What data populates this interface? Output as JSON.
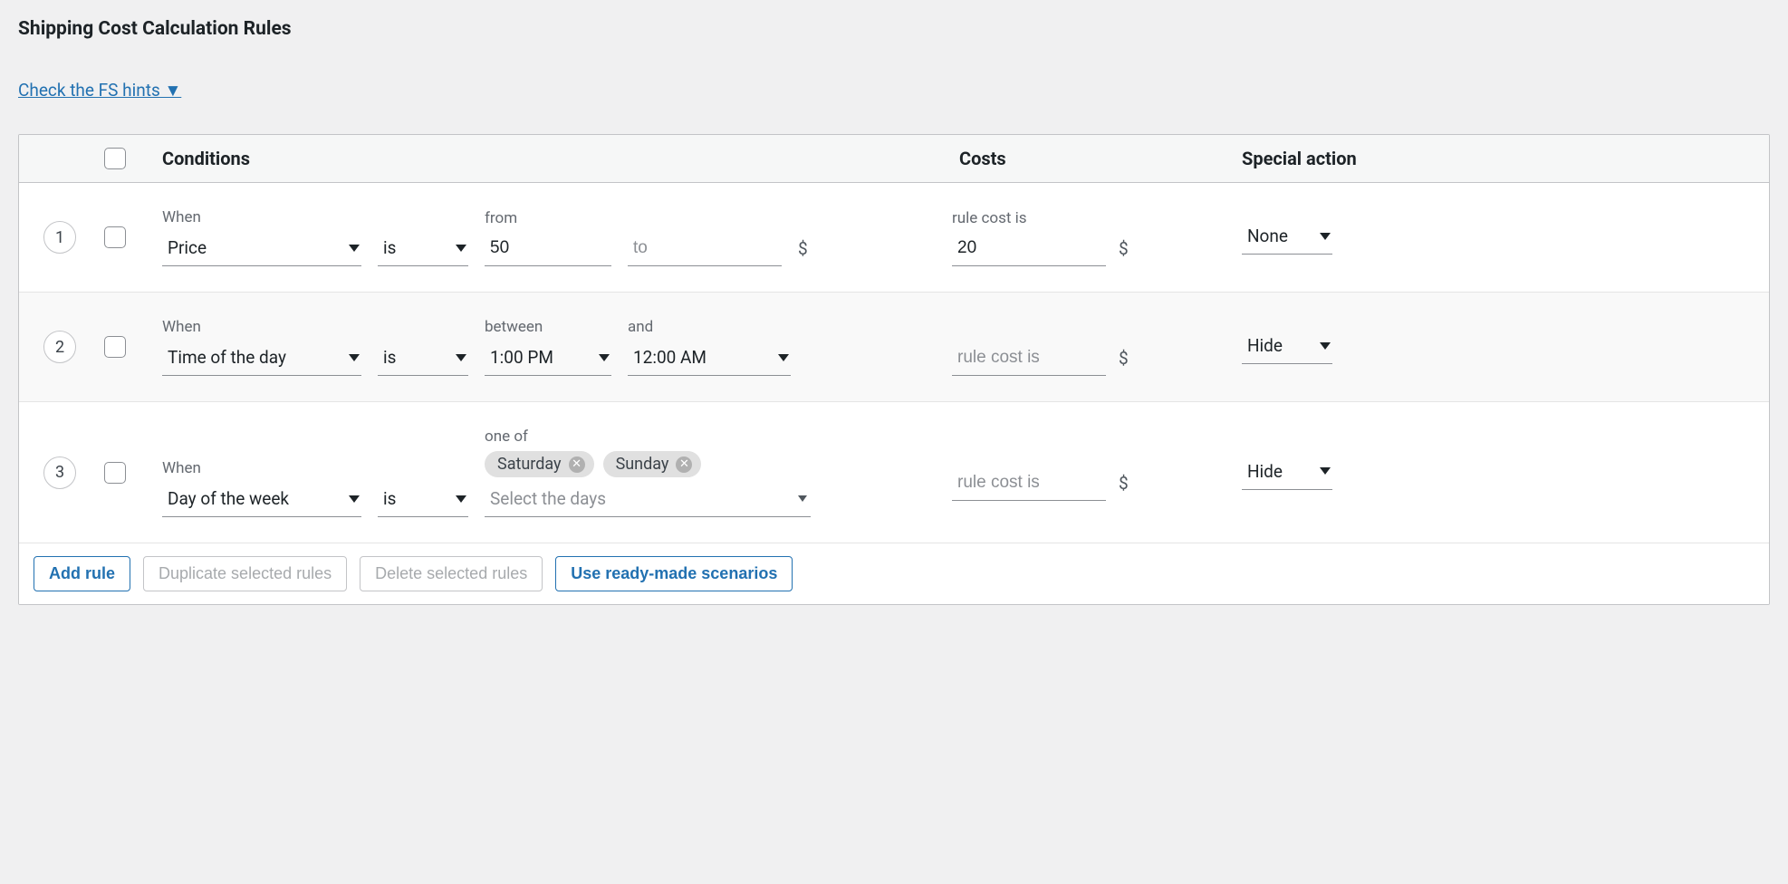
{
  "title": "Shipping Cost Calculation Rules",
  "hint_link": "Check the FS hints ▼",
  "headers": {
    "conditions": "Conditions",
    "costs": "Costs",
    "special": "Special action"
  },
  "labels": {
    "when": "When",
    "from": "from",
    "between": "between",
    "and": "and",
    "one_of": "one of",
    "rule_cost_is": "rule cost is",
    "is": "is",
    "to_placeholder": "to",
    "rule_cost_placeholder": "rule cost is",
    "select_days_placeholder": "Select the days",
    "currency": "$"
  },
  "rules": [
    {
      "num": "1",
      "when": "Price",
      "operator": "is",
      "from": "50",
      "to": "",
      "cost": "20",
      "special": "None"
    },
    {
      "num": "2",
      "when": "Time of the day",
      "operator": "is",
      "between": "1:00 PM",
      "and": "12:00 AM",
      "cost": "",
      "special": "Hide"
    },
    {
      "num": "3",
      "when": "Day of the week",
      "operator": "is",
      "chips": [
        "Saturday",
        "Sunday"
      ],
      "cost": "",
      "special": "Hide"
    }
  ],
  "buttons": {
    "add": "Add rule",
    "duplicate": "Duplicate selected rules",
    "delete": "Delete selected rules",
    "scenarios": "Use ready-made scenarios"
  }
}
